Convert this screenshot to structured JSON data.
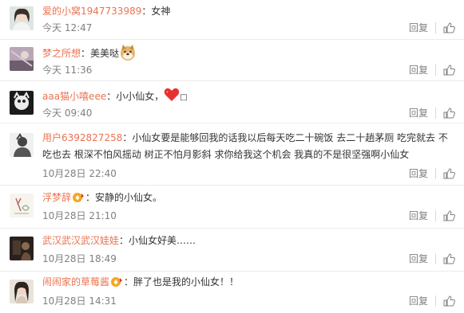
{
  "actions": {
    "reply_label": "回复"
  },
  "colors": {
    "username": "#eb7350",
    "meta": "#808080",
    "divider": "#ececec"
  },
  "comments": [
    {
      "user": "爱的小窝1947733989",
      "text": "女神",
      "time": "今天 12:47",
      "emoji": null,
      "badge": false
    },
    {
      "user": "梦之所想",
      "text": "美美哒",
      "time": "今天 11:36",
      "emoji": "doge-icon",
      "badge": false
    },
    {
      "user": "aaa猫小嘻eee",
      "text": "小小仙女，",
      "time": "今天 09:40",
      "emoji": "heart-icon",
      "badge": false
    },
    {
      "user": "用户6392827258",
      "text": "小仙女要是能够回我的话我以后每天吃二十碗饭 去二十趟茅厕 吃完就去 不吃也去 根深不怕风摇动 树正不怕月影斜 求你给我这个机会 我真的不是很坚强啊小仙女",
      "time": "10月28日 22:40",
      "emoji": null,
      "badge": false
    },
    {
      "user": "浮梦辞",
      "text": "安静的小仙女。",
      "time": "10月28日 21:10",
      "emoji": null,
      "badge": true
    },
    {
      "user": "武汉武汉武汉娃娃",
      "text": "小仙女好美……",
      "time": "10月28日 18:49",
      "emoji": null,
      "badge": false
    },
    {
      "user": "闹闹家的草莓酱",
      "text": "胖了也是我的小仙女！！",
      "time": "10月28日 14:31",
      "emoji": null,
      "badge": true
    }
  ]
}
